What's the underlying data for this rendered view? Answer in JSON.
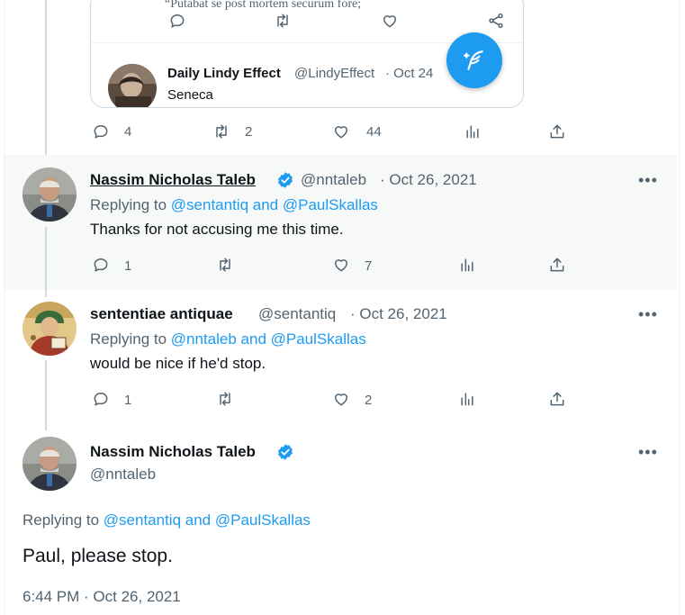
{
  "quote_card": {
    "partial_text": "“Putabat se post mortem securum fore;",
    "nested": {
      "name": "Daily Lindy Effect",
      "handle": "@LindyEffect",
      "date": "· Oct 24",
      "text": "Seneca"
    }
  },
  "tweet0_actions": {
    "replies": "4",
    "retweets": "2",
    "likes": "44"
  },
  "tweets": [
    {
      "name": "Nassim Nicholas Taleb",
      "handle": "@nntaleb",
      "date": "· Oct 26, 2021",
      "replying_prefix": "Replying to ",
      "replying_handles": "@sentantiq and @PaulSkallas",
      "text": "Thanks for not accusing me this time.",
      "replies": "1",
      "retweets": "",
      "likes": "7"
    },
    {
      "name": "sententiae antiquae",
      "handle": "@sentantiq",
      "date": "· Oct 26, 2021",
      "replying_prefix": "Replying to ",
      "replying_handles": "@nntaleb and @PaulSkallas",
      "text": "would be nice if he'd stop.",
      "replies": "1",
      "retweets": "",
      "likes": "2"
    }
  ],
  "main_tweet": {
    "name": "Nassim Nicholas Taleb",
    "handle": "@nntaleb",
    "replying_prefix": "Replying to ",
    "replying_handles": "@sentantiq and @PaulSkallas",
    "text": "Paul, please stop.",
    "timestamp": "6:44 PM · Oct 26, 2021"
  },
  "more_label": "•••",
  "colors": {
    "accent": "#1d9bf0",
    "muted": "#536471",
    "text": "#0f1419",
    "highlight": "#f7f9f9"
  }
}
